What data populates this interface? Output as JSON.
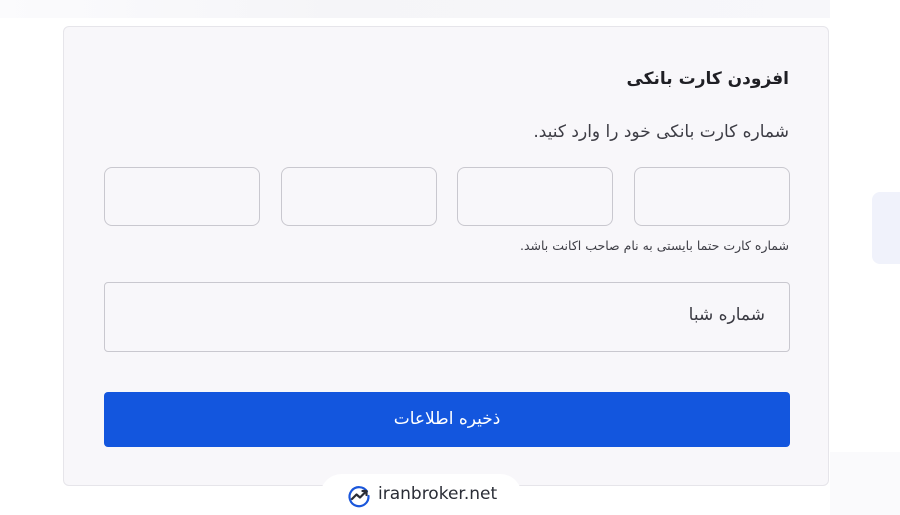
{
  "form": {
    "title": "افزودن کارت بانکی",
    "subtitle": "شماره کارت بانکی خود را وارد کنید.",
    "card_number_fields": [
      "",
      "",
      "",
      ""
    ],
    "hint": "شماره کارت حتما بایستی به نام صاحب اکانت باشد.",
    "sheba_placeholder": "شماره شبا",
    "save_label": "ذخیره اطلاعات"
  },
  "watermark": {
    "text": "iranbroker.net",
    "icon": "trend-chart-icon"
  },
  "colors": {
    "primary": "#1356de",
    "card_background": "#f8f7fa",
    "border": "#c9c8cf",
    "text": "#1f1f24"
  }
}
